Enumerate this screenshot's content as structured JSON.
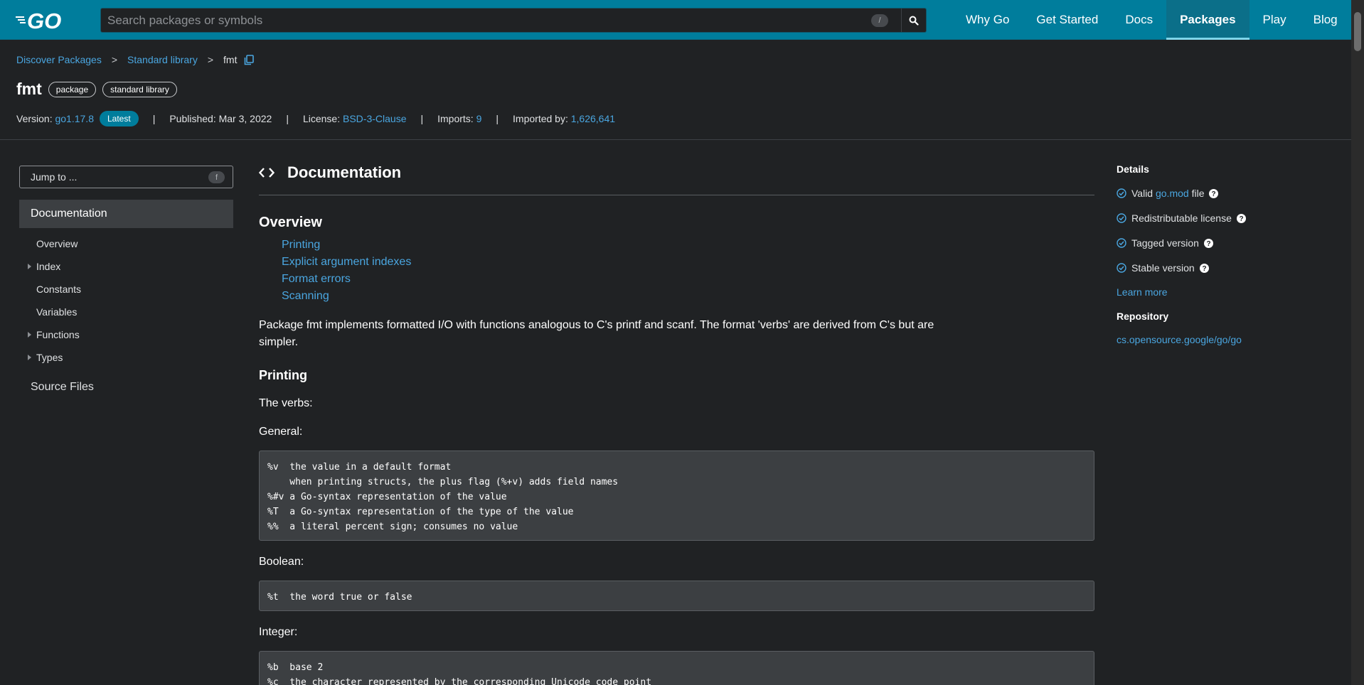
{
  "header": {
    "logo_text": "GO",
    "search_placeholder": "Search packages or symbols",
    "search_shortcut": "/",
    "nav": [
      "Why Go",
      "Get Started",
      "Docs",
      "Packages",
      "Play",
      "Blog"
    ],
    "active_nav": "Packages"
  },
  "breadcrumb": {
    "items": [
      "Discover Packages",
      "Standard library",
      "fmt"
    ],
    "separator": ">"
  },
  "package": {
    "name": "fmt",
    "tags": [
      "package",
      "standard library"
    ],
    "version_label": "Version:",
    "version": "go1.17.8",
    "latest_badge": "Latest",
    "published": "Published: Mar 3, 2022",
    "license_label": "License:",
    "license": "BSD-3-Clause",
    "imports_label": "Imports:",
    "imports": "9",
    "imported_by_label": "Imported by:",
    "imported_by": "1,626,641"
  },
  "sidebar": {
    "jump_placeholder": "Jump to ...",
    "jump_shortcut": "f",
    "documentation": "Documentation",
    "items": [
      {
        "label": "Overview",
        "expandable": false
      },
      {
        "label": "Index",
        "expandable": true
      },
      {
        "label": "Constants",
        "expandable": false
      },
      {
        "label": "Variables",
        "expandable": false
      },
      {
        "label": "Functions",
        "expandable": true
      },
      {
        "label": "Types",
        "expandable": true
      }
    ],
    "source_files": "Source Files"
  },
  "main": {
    "doc_title": "Documentation",
    "overview_heading": "Overview",
    "overview_links": [
      "Printing",
      "Explicit argument indexes",
      "Format errors",
      "Scanning"
    ],
    "intro": "Package fmt implements formatted I/O with functions analogous to C's printf and scanf. The format 'verbs' are derived from C's but are simpler.",
    "printing_heading": "Printing",
    "verbs_text": "The verbs:",
    "general_label": "General:",
    "general_code": "%v  the value in a default format\n    when printing structs, the plus flag (%+v) adds field names\n%#v a Go-syntax representation of the value\n%T  a Go-syntax representation of the type of the value\n%%  a literal percent sign; consumes no value",
    "boolean_label": "Boolean:",
    "boolean_code": "%t  the word true or false",
    "integer_label": "Integer:",
    "integer_code": "%b  base 2\n%c  the character represented by the corresponding Unicode code point"
  },
  "details": {
    "heading": "Details",
    "valid_prefix": "Valid",
    "valid_link": "go.mod",
    "valid_suffix": "file",
    "items": [
      "Redistributable license",
      "Tagged version",
      "Stable version"
    ],
    "learn_more": "Learn more",
    "repository_heading": "Repository",
    "repository_link": "cs.opensource.google/go/go"
  },
  "colors": {
    "header_bg": "#007d9c",
    "page_bg": "#202224",
    "link": "#4aa6e0",
    "code_bg": "#3c3f42"
  }
}
